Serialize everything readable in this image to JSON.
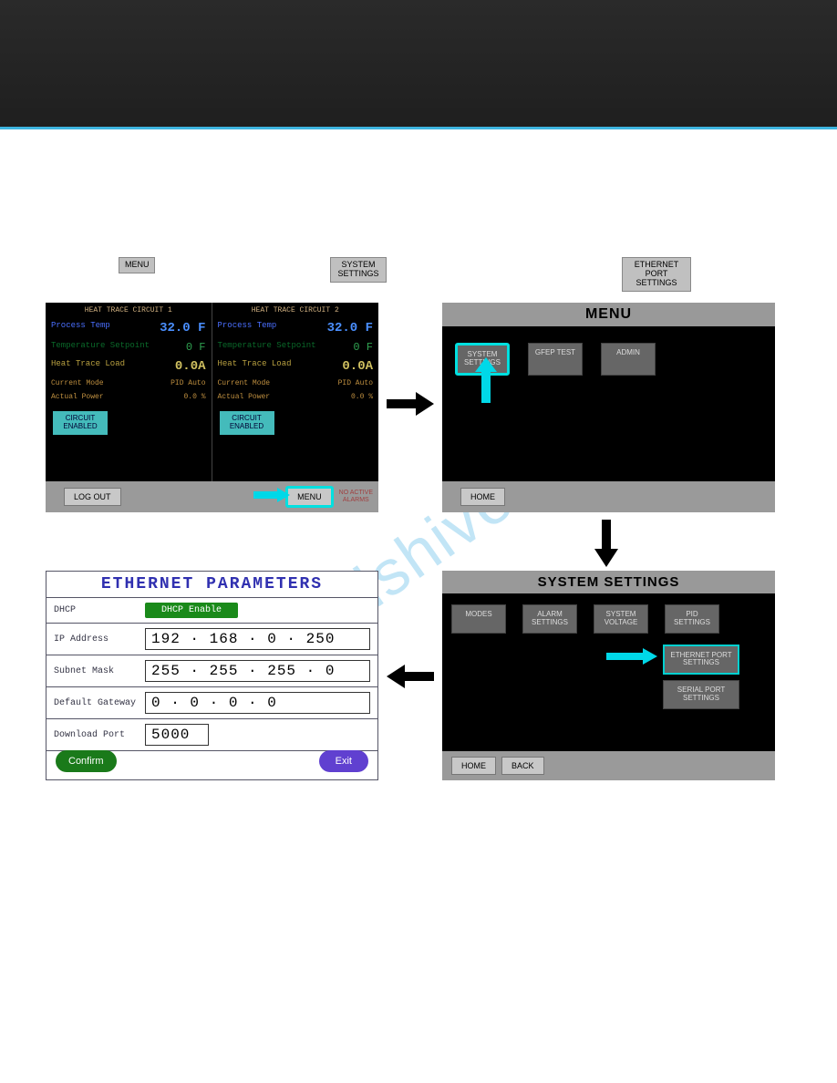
{
  "labels": {
    "menu": "MENU",
    "system_settings": "SYSTEM\nSETTINGS",
    "ethernet_port_settings": "ETHERNET\nPORT SETTINGS"
  },
  "tl": {
    "c1": {
      "title": "HEAT TRACE CIRCUIT 1",
      "pt_lab": "Process Temp",
      "pt_val": "32.0 F",
      "ts_lab": "Temperature Setpoint",
      "ts_val": "0 F",
      "hl_lab": "Heat Trace Load",
      "hl_val": "0.0A",
      "cm_lab": "Current Mode",
      "cm_val": "PID Auto",
      "ap_lab": "Actual Power",
      "ap_val": "0.0 %",
      "btn": "CIRCUIT\nENABLED"
    },
    "c2": {
      "title": "HEAT TRACE CIRCUIT 2",
      "pt_lab": "Process Temp",
      "pt_val": "32.0 F",
      "ts_lab": "Temperature Setpoint",
      "ts_val": "0 F",
      "hl_lab": "Heat Trace Load",
      "hl_val": "0.0A",
      "cm_lab": "Current Mode",
      "cm_val": "PID Auto",
      "ap_lab": "Actual Power",
      "ap_val": "0.0 %",
      "btn": "CIRCUIT\nENABLED"
    },
    "footer": {
      "logout": "LOG OUT",
      "menu": "MENU",
      "status": "NO ACTIVE\nALARMS"
    }
  },
  "tr": {
    "title": "MENU",
    "b1": "SYSTEM\nSETTINGS",
    "b2": "GFEP TEST",
    "b3": "ADMIN",
    "home": "HOME"
  },
  "br": {
    "title": "SYSTEM SETTINGS",
    "b1": "MODES",
    "b2": "ALARM\nSETTINGS",
    "b3": "SYSTEM\nVOLTAGE",
    "b4": "PID SETTINGS",
    "b5": "ETHERNET\nPORT SETTINGS",
    "b6": "SERIAL PORT\nSETTINGS",
    "home": "HOME",
    "back": "BACK"
  },
  "bl": {
    "title": "ETHERNET PARAMETERS",
    "dhcp_lab": "DHCP",
    "dhcp_btn": "DHCP Enable",
    "ip_lab": "IP Address",
    "ip_val": "192 · 168 · 0   · 250",
    "sm_lab": "Subnet Mask",
    "sm_val": "255 · 255 · 255 · 0",
    "gw_lab": "Default Gateway",
    "gw_val": "0   · 0   · 0   · 0",
    "dp_lab": "Download Port",
    "dp_val": "5000",
    "confirm": "Confirm",
    "exit": "Exit"
  },
  "watermark": "manualshive.com"
}
